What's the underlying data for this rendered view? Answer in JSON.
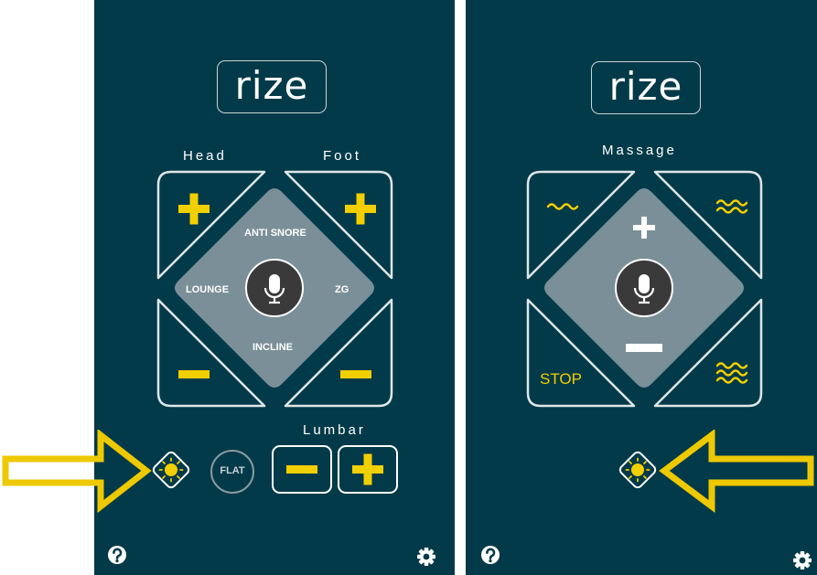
{
  "colors": {
    "background": "#033a49",
    "accent_yellow": "#f2cf00",
    "outline": "#dfe6e8",
    "center_pad": "#7b8f98",
    "mic_circle": "#3a3a3a",
    "arrow_yellow": "#eec900"
  },
  "left_screen": {
    "logo": "rize",
    "head_label": "Head",
    "foot_label": "Foot",
    "head_up_icon": "plus-icon",
    "head_down_icon": "minus-icon",
    "foot_up_icon": "plus-icon",
    "foot_down_icon": "minus-icon",
    "preset_top": "ANTI SNORE",
    "preset_left": "LOUNGE",
    "preset_right": "ZG",
    "preset_bottom": "INCLINE",
    "mic_icon": "microphone-icon",
    "light_icon": "light-bulb-icon",
    "flat_label": "FLAT",
    "lumbar_label": "Lumbar",
    "help_icon": "question-icon",
    "settings_icon": "gear-icon"
  },
  "right_screen": {
    "logo": "rize",
    "massage_label": "Massage",
    "massage_low_icon": "wave-low-icon",
    "massage_medium_icon": "wave-medium-icon",
    "massage_high_icon": "wave-high-icon",
    "stop_label": "STOP",
    "increase_icon": "plus-icon",
    "decrease_icon": "minus-icon",
    "mic_icon": "microphone-icon",
    "light_icon": "light-bulb-icon",
    "help_icon": "question-icon",
    "settings_icon": "gear-icon"
  },
  "annotations": {
    "left_arrow": "arrow-right",
    "right_arrow": "arrow-left"
  }
}
